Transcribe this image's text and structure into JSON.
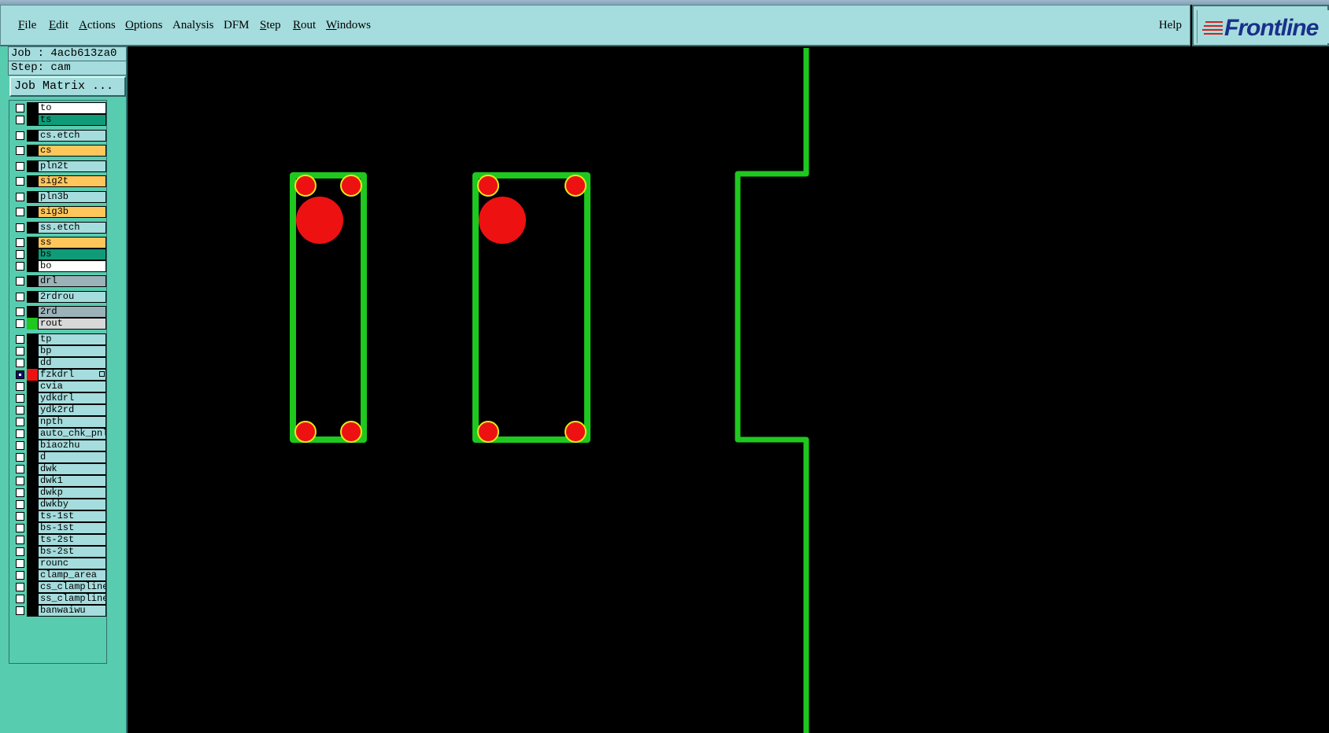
{
  "menu": {
    "items": [
      {
        "label": "File",
        "name": "menu-file"
      },
      {
        "label": "Edit",
        "name": "menu-edit"
      },
      {
        "label": "Actions",
        "name": "menu-actions"
      },
      {
        "label": "Options",
        "name": "menu-options"
      },
      {
        "label": "Analysis",
        "name": "menu-analysis"
      },
      {
        "label": "DFM",
        "name": "menu-dfm"
      },
      {
        "label": "Step",
        "name": "menu-step"
      },
      {
        "label": "Rout",
        "name": "menu-rout"
      },
      {
        "label": "Windows",
        "name": "menu-windows"
      }
    ],
    "help_label": "Help"
  },
  "logo": {
    "text": "Frontline"
  },
  "job": {
    "label": "Job : 4acb613za0",
    "step": "Step: cam"
  },
  "job_matrix_label": "Job Matrix ...",
  "layers": [
    {
      "name": "to",
      "color": "#ffffff",
      "checked": false
    },
    {
      "name": "ts",
      "color": "#0f9b78",
      "checked": false
    },
    {
      "name": "cs.etch",
      "color": "#a5dcdd",
      "checked": false
    },
    {
      "name": "cs",
      "color": "#ffc65c",
      "checked": false
    },
    {
      "name": "pln2t",
      "color": "#a5dcdd",
      "checked": false
    },
    {
      "name": "sig2t",
      "color": "#ffc65c",
      "checked": false
    },
    {
      "name": "pln3b",
      "color": "#a5dcdd",
      "checked": false
    },
    {
      "name": "sig3b",
      "color": "#ffc65c",
      "checked": false
    },
    {
      "name": "ss.etch",
      "color": "#a5dcdd",
      "checked": false
    },
    {
      "name": "ss",
      "color": "#ffc65c",
      "checked": false
    },
    {
      "name": "bs",
      "color": "#0f9b78",
      "checked": false
    },
    {
      "name": "bo",
      "color": "#ffffff",
      "checked": false
    },
    {
      "name": "drl",
      "color": "#9ab2b8",
      "checked": false
    },
    {
      "name": "2rdrou",
      "color": "#a5dcdd",
      "checked": false
    },
    {
      "name": "2rd",
      "color": "#9ab2b8",
      "checked": false
    },
    {
      "name": "rout",
      "color": "#d8d8d8",
      "checked": false,
      "swatch": "#1ec81e"
    },
    {
      "name": "tp",
      "color": "#a5dcdd",
      "checked": false
    },
    {
      "name": "bp",
      "color": "#a5dcdd",
      "checked": false
    },
    {
      "name": "dd",
      "color": "#a5dcdd",
      "checked": false
    },
    {
      "name": "fzkdrl",
      "color": "#a5dcdd",
      "checked": true,
      "swatch": "#ee1111",
      "affected": true
    },
    {
      "name": "cvia",
      "color": "#a5dcdd",
      "checked": false
    },
    {
      "name": "ydkdrl",
      "color": "#a5dcdd",
      "checked": false
    },
    {
      "name": "ydk2rd",
      "color": "#a5dcdd",
      "checked": false
    },
    {
      "name": "npth",
      "color": "#a5dcdd",
      "checked": false
    },
    {
      "name": "auto_chk_pnl",
      "color": "#a5dcdd",
      "checked": false
    },
    {
      "name": "biaozhu",
      "color": "#a5dcdd",
      "checked": false
    },
    {
      "name": "d",
      "color": "#a5dcdd",
      "checked": false
    },
    {
      "name": "dwk",
      "color": "#a5dcdd",
      "checked": false
    },
    {
      "name": "dwk1",
      "color": "#a5dcdd",
      "checked": false
    },
    {
      "name": "dwkp",
      "color": "#a5dcdd",
      "checked": false
    },
    {
      "name": "dwkby",
      "color": "#a5dcdd",
      "checked": false
    },
    {
      "name": "ts-1st",
      "color": "#a5dcdd",
      "checked": false
    },
    {
      "name": "bs-1st",
      "color": "#a5dcdd",
      "checked": false
    },
    {
      "name": "ts-2st",
      "color": "#a5dcdd",
      "checked": false
    },
    {
      "name": "bs-2st",
      "color": "#a5dcdd",
      "checked": false
    },
    {
      "name": "rounc",
      "color": "#a5dcdd",
      "checked": false
    },
    {
      "name": "clamp_area",
      "color": "#a5dcdd",
      "checked": false
    },
    {
      "name": "cs_clampline",
      "color": "#a5dcdd",
      "checked": false
    },
    {
      "name": "ss_clampline",
      "color": "#a5dcdd",
      "checked": false
    },
    {
      "name": "banwaiwu",
      "color": "#a5dcdd",
      "checked": false
    }
  ],
  "colors": {
    "rout_line": "#1ec81e",
    "drill_pad": "#ee1111",
    "highlight": "#e8e81a"
  }
}
